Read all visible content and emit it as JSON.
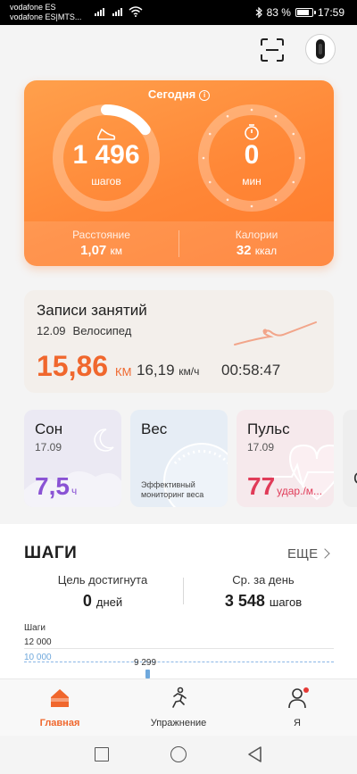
{
  "status_bar": {
    "carrier1": "vodafone ES",
    "carrier2": "vodafone ES|MTS...",
    "battery": "83 %",
    "time": "17:59"
  },
  "today": {
    "title": "Сегодня",
    "steps_value": "1 496",
    "steps_unit": "шагов",
    "steps_progress": 0.15,
    "exercise_value": "0",
    "exercise_unit": "мин",
    "distance_label": "Расстояние",
    "distance_value": "1,07",
    "distance_unit": "км",
    "calories_label": "Калории",
    "calories_value": "32",
    "calories_unit": "ккал"
  },
  "activity": {
    "title": "Записи занятий",
    "date": "12.09",
    "type": "Велосипед",
    "distance": "15,86",
    "distance_unit": "КМ",
    "speed": "16,19",
    "speed_unit": "км/ч",
    "duration": "00:58:47"
  },
  "sleep": {
    "title": "Сон",
    "date": "17.09",
    "value": "7,5",
    "unit": "ч"
  },
  "weight": {
    "title": "Вес",
    "desc": "Эффективный мониторинг веса"
  },
  "pulse": {
    "title": "Пульс",
    "date": "17.09",
    "value": "77",
    "unit": "удар./м..."
  },
  "next_card_letter": "С",
  "steps_section": {
    "title": "ШАГИ",
    "more": "ЕЩЕ",
    "goal_label": "Цель достигнута",
    "goal_value": "0",
    "goal_unit": "дней",
    "avg_label": "Ср. за день",
    "avg_value": "3 548",
    "avg_unit": "шагов"
  },
  "chart_data": {
    "type": "bar",
    "title": "Шаги",
    "y_tick_top": "12 000",
    "goal_line": "10 000",
    "bar_label": "9 299",
    "values": [
      9299
    ]
  },
  "nav": {
    "home": "Главная",
    "exercise": "Упражнение",
    "me": "Я"
  },
  "colors": {
    "accent": "#f0672d",
    "sleep": "#8a53d4",
    "pulse": "#e03b58"
  }
}
